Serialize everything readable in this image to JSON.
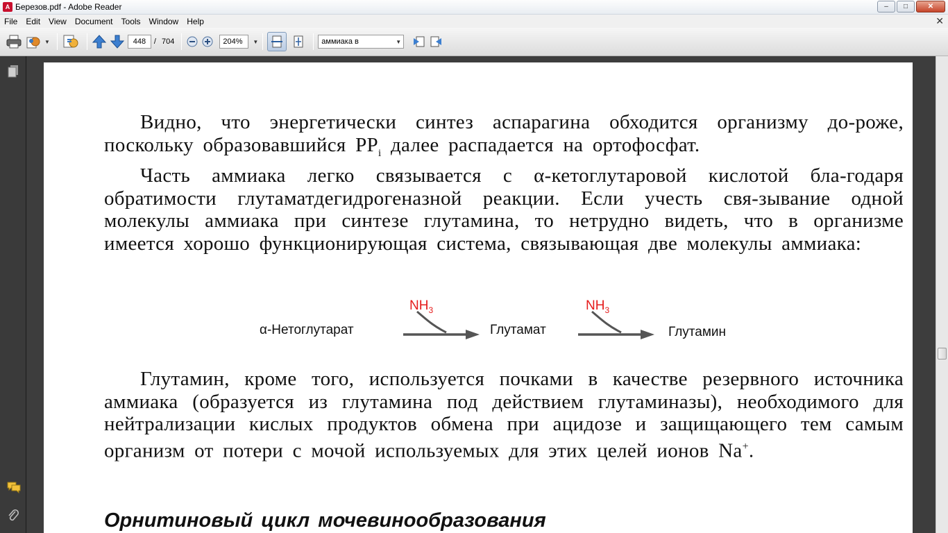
{
  "window": {
    "title": "Березов.pdf - Adobe Reader",
    "app_icon_text": "A",
    "controls": {
      "minimize": "–",
      "maximize": "□",
      "close": "✕"
    }
  },
  "menu": {
    "items": [
      "File",
      "Edit",
      "View",
      "Document",
      "Tools",
      "Window",
      "Help"
    ],
    "close_glyph": "✕"
  },
  "toolbar": {
    "page_current": "448",
    "page_separator": "/",
    "page_total": "704",
    "zoom_value": "204%",
    "search_value": "аммиака в",
    "dropdown_glyph": "▼"
  },
  "document": {
    "paragraph1_a": "Видно, что энергетически синтез аспарагина обходится организму до-роже, поскольку образовавшийся PP",
    "paragraph1_sub": "i",
    "paragraph1_b": " далее распадается на ортофосфат.",
    "paragraph2": "Часть аммиака легко связывается с α-кетоглутаровой кислотой бла-годаря обратимости глутаматдегидрогеназной реакции. Если учесть свя-зывание одной молекулы аммиака при синтезе глутамина, то нетрудно видеть, что в организме имеется хорошо функционирующая система, связывающая две молекулы аммиака:",
    "scheme": {
      "substrate": "α-Нетоглутарат",
      "intermediate": "Глутамат",
      "product": "Глутамин",
      "reagent1_main": "NH",
      "reagent1_sub": "3",
      "reagent2_main": "NH",
      "reagent2_sub": "3"
    },
    "paragraph3_a": "Глутамин, кроме того, используется почками в качестве резервного источника аммиака (образуется из глутамина под действием глутаминазы), необходимого для нейтрализации кислых продуктов обмена при ацидозе и защищающего тем самым организм от потери с мочой используемых для этих целей ионов Na",
    "paragraph3_sup": "+",
    "paragraph3_b": ".",
    "heading": "Орнитиновый цикл мочевинообразования"
  },
  "colors": {
    "reagent": "#e51b1b",
    "page_background": "#ffffff",
    "workspace_background": "#3d3d3d"
  },
  "icons": {
    "sidebar_top": "pages-icon",
    "sidebar_comments": "comments-icon",
    "sidebar_attachments": "paperclip-icon"
  }
}
